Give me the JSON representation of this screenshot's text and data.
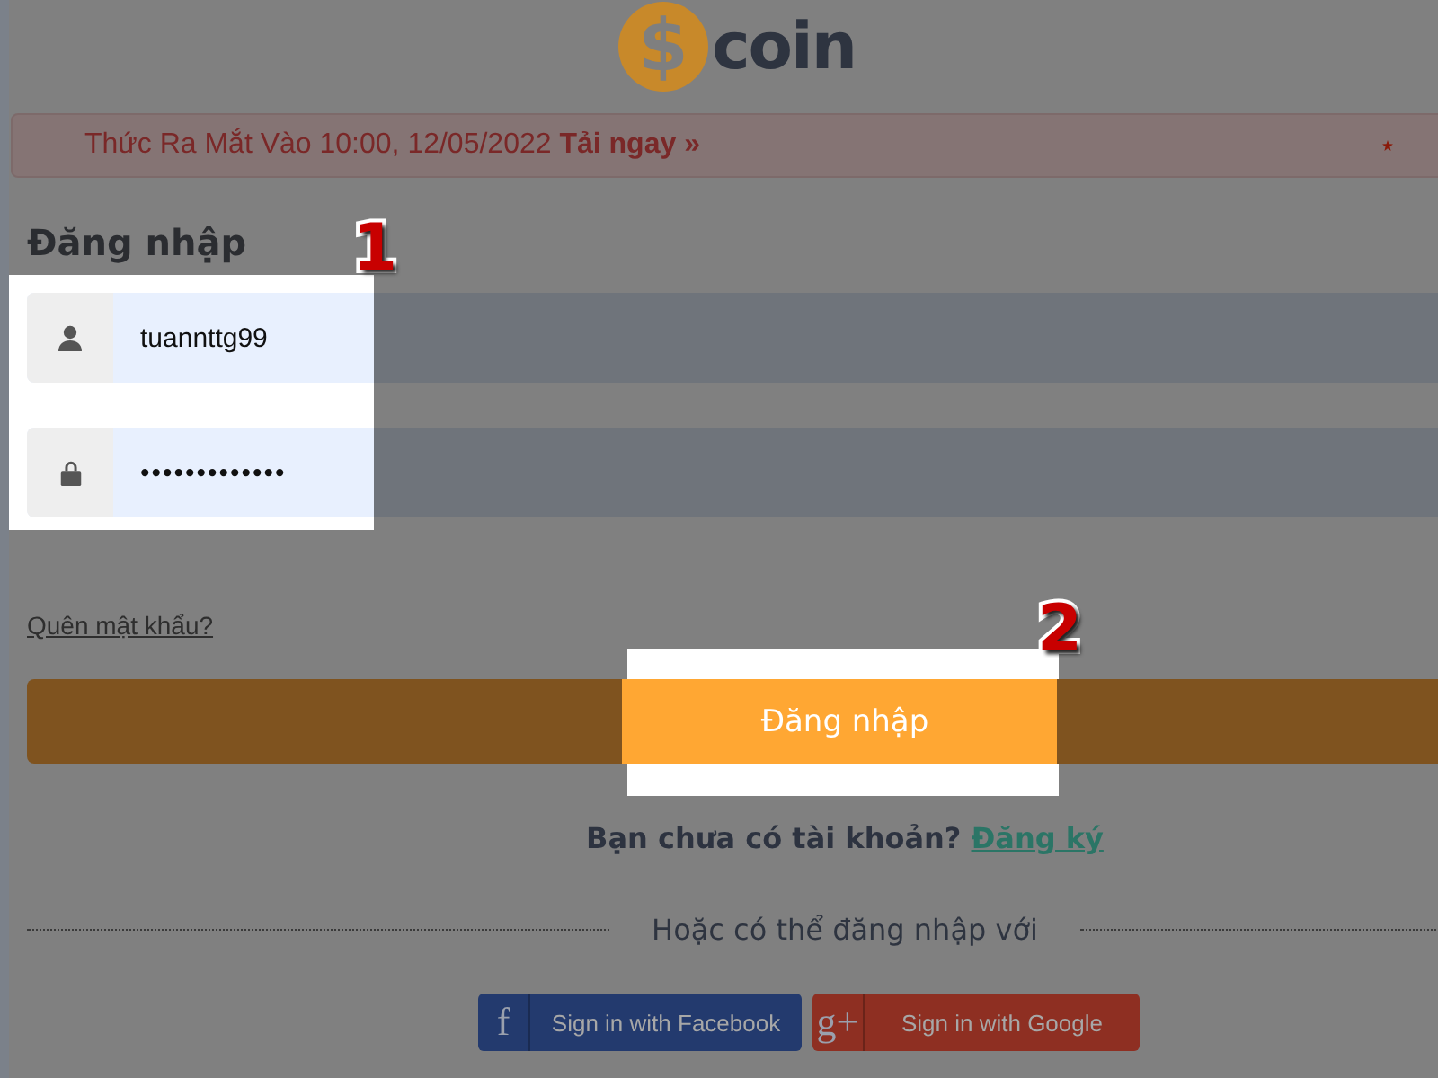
{
  "logo": {
    "symbol": "$",
    "text": "coin"
  },
  "banner": {
    "text": "Thức Ra Mắt Vào 10:00, 12/05/2022 **Tải ngay »**"
  },
  "login": {
    "title": "Đăng nhập",
    "username": {
      "value": "tuannttg99"
    },
    "password": {
      "value": "•••••••••••••"
    },
    "forgot_link": "Quên mật khẩu?",
    "submit_button": "Đăng nhập",
    "signup_prompt": "Bạn chưa có tài khoản?",
    "signup_link": "Đăng ký",
    "divider_text": "Hoặc có thể đăng nhập với"
  },
  "social_buttons": [
    {
      "kind": "facebook",
      "icon_text": "f",
      "label": "Sign in with Facebook"
    },
    {
      "kind": "google",
      "icon_text": "g+",
      "label": "Sign in with Google"
    }
  ],
  "annotations": [
    {
      "label": "1"
    },
    {
      "label": "2"
    }
  ]
}
